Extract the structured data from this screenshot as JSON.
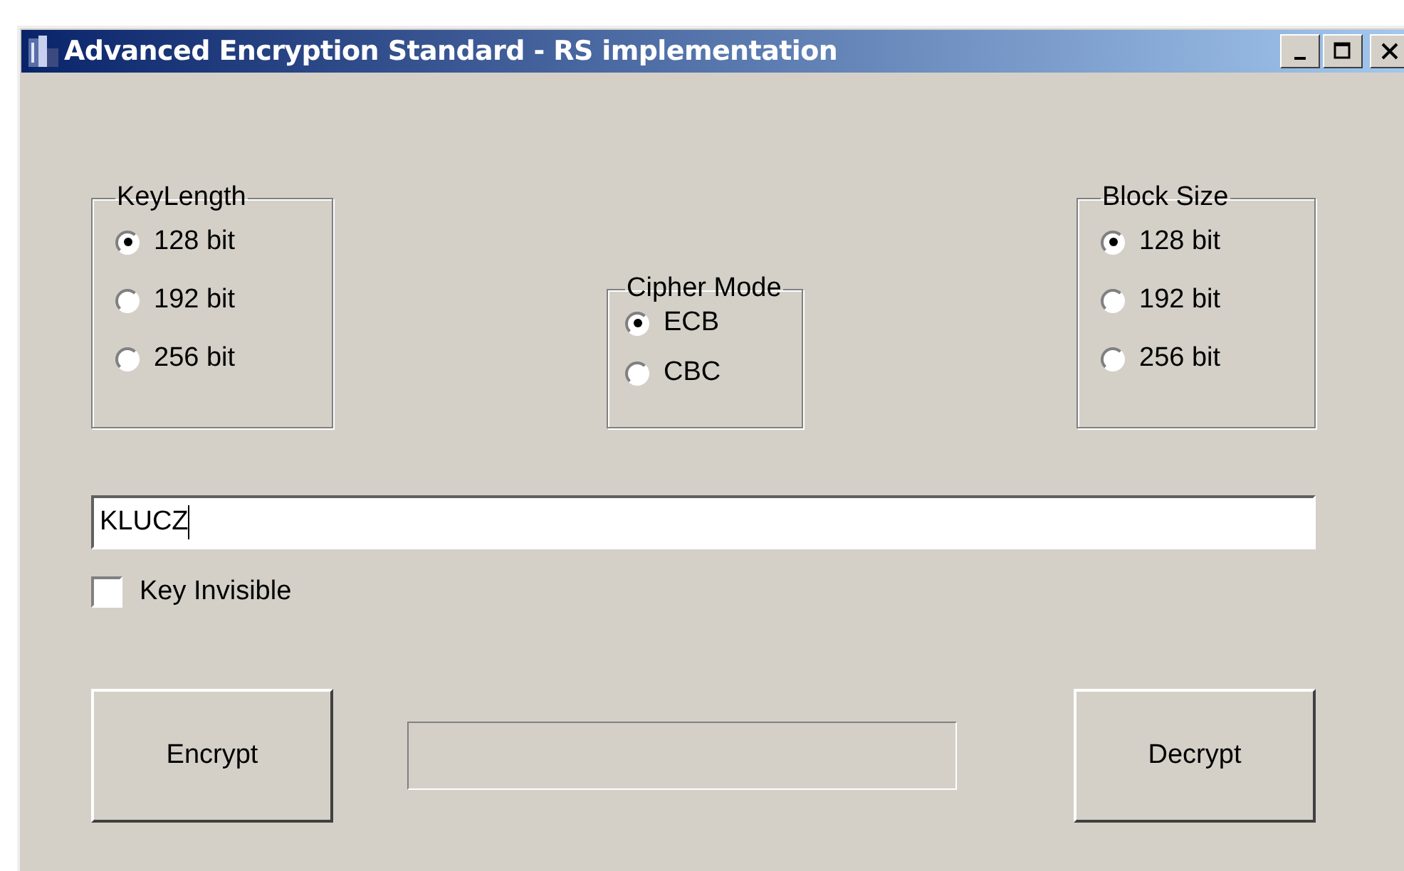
{
  "window": {
    "title": "Advanced Encryption Standard - RS implementation"
  },
  "groups": [
    {
      "title": "KeyLength",
      "options": [
        {
          "label": "128 bit",
          "selected": true
        },
        {
          "label": "192 bit",
          "selected": false
        },
        {
          "label": "256 bit",
          "selected": false
        }
      ]
    },
    {
      "title": "Cipher Mode",
      "options": [
        {
          "label": "ECB",
          "selected": true
        },
        {
          "label": "CBC",
          "selected": false
        }
      ]
    },
    {
      "title": "Block Size",
      "options": [
        {
          "label": "128 bit",
          "selected": true
        },
        {
          "label": "192 bit",
          "selected": false
        },
        {
          "label": "256 bit",
          "selected": false
        }
      ]
    }
  ],
  "key_field": {
    "value": "KLUCZ"
  },
  "key_invisible": {
    "label": "Key Invisible",
    "checked": false
  },
  "buttons": [
    {
      "label": "Encrypt"
    },
    {
      "label": "Decrypt"
    }
  ]
}
